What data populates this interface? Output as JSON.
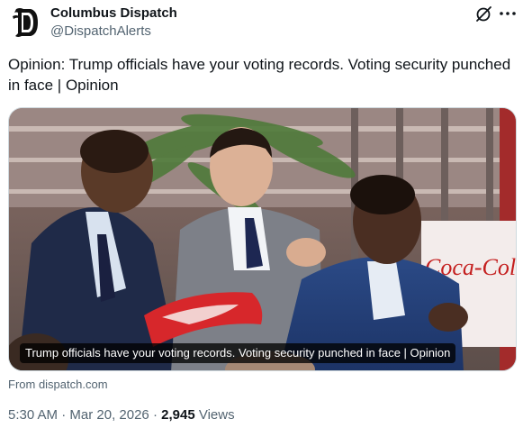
{
  "tweet": {
    "author_name": "Columbus Dispatch",
    "author_handle": "@DispatchAlerts",
    "avatar_icon": "gothic-d-logo",
    "text": "Opinion: Trump officials have your voting records. Voting security punched in face | Opinion",
    "link_card": {
      "caption": "Trump officials have your voting records. Voting security punched in face | Opinion",
      "source": "From dispatch.com",
      "sign_text": "Coca-Cola"
    },
    "time": "5:30 AM",
    "separator": "·",
    "date": "Mar 20, 2026",
    "views_count": "2,945",
    "views_label": "Views"
  },
  "colors": {
    "text_primary": "#0f1419",
    "text_secondary": "#536471",
    "border": "#cfd9de"
  }
}
